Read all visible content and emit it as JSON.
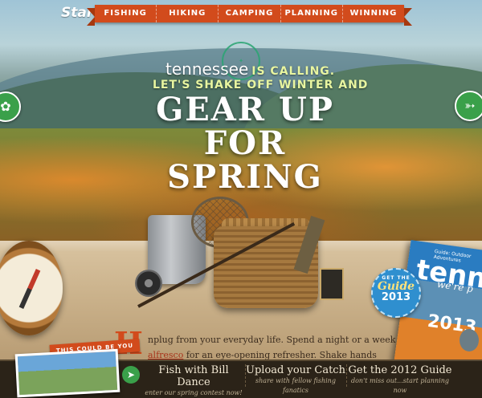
{
  "nav": {
    "logo": "Start",
    "items": [
      "FISHING",
      "HIKING",
      "CAMPING",
      "PLANNING",
      "WINNING"
    ]
  },
  "hero": {
    "tn_word": "tennessee",
    "tn_call": "IS CALLING.",
    "subline": "LET'S SHAKE OFF WINTER AND",
    "headline_1": "GEAR UP FOR",
    "headline_2": "SPRING"
  },
  "guide_badge": {
    "get": "GET THE",
    "guide": "Guide",
    "year": "2013"
  },
  "magazine": {
    "brand": "Guide: Outdoor Adventures",
    "title": "tenn",
    "subtitle": "we're p",
    "year": "2013"
  },
  "article": {
    "dropcap": "H",
    "text_before_link": "nplug from your everyday life. Spend a night or a week ",
    "link": "alfresco",
    "text_after_link": " for an eye-opening refresher. Shake hands with some of the best angling"
  },
  "ribbon": "THIS COULD BE YOU",
  "bottom": {
    "ctas": [
      {
        "title": "Fish with Bill Dance",
        "sub": "enter our spring contest now!"
      },
      {
        "title": "Upload your Catch",
        "sub": "share with fellow fishing fanatics"
      },
      {
        "title": "Get the 2012 Guide",
        "sub": "don't miss out...start planning now"
      }
    ]
  },
  "colors": {
    "accent_orange": "#d24b1c",
    "accent_green": "#3aa04a",
    "bottom_bar": "#2b2318"
  },
  "icons": [
    "hiker-icon",
    "fish-icon",
    "play-arrow-icon"
  ]
}
